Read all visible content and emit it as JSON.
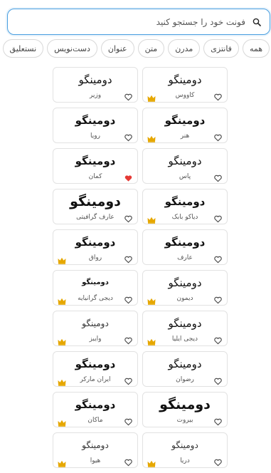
{
  "search": {
    "placeholder": "فونت خود را جستجو کنید",
    "icon": "search-icon"
  },
  "chips": [
    "همه",
    "فانتزی",
    "مدرن",
    "متن",
    "عنوان",
    "دست‌نویس",
    "نستعلیق"
  ],
  "sample_text": "دومینگو",
  "colors": {
    "accent": "#4a9fe0",
    "crown": "#e6a700",
    "heart_active": "#e53935"
  },
  "fonts": [
    {
      "name": "کاووس",
      "premium": true,
      "liked": false,
      "style": "light"
    },
    {
      "name": "وزیر",
      "premium": false,
      "liked": false,
      "style": "light"
    },
    {
      "name": "هنر",
      "premium": true,
      "liked": false,
      "style": "bold"
    },
    {
      "name": "رویا",
      "premium": false,
      "liked": false,
      "style": "bold"
    },
    {
      "name": "پاس",
      "premium": false,
      "liked": false,
      "style": "light"
    },
    {
      "name": "کمان",
      "premium": false,
      "liked": true,
      "style": "bold"
    },
    {
      "name": "دیاکو بابک",
      "premium": true,
      "liked": false,
      "style": "bold"
    },
    {
      "name": "عارف گرافیتی",
      "premium": false,
      "liked": false,
      "style": "heavy"
    },
    {
      "name": "عارف",
      "premium": false,
      "liked": false,
      "style": "bold"
    },
    {
      "name": "رواق",
      "premium": true,
      "liked": false,
      "style": "bold"
    },
    {
      "name": "دیمون",
      "premium": true,
      "liked": false,
      "style": "light"
    },
    {
      "name": "دیجی گرانیایه",
      "premium": true,
      "liked": false,
      "style": "tiny"
    },
    {
      "name": "دیجی ایلیا",
      "premium": true,
      "liked": false,
      "style": "light"
    },
    {
      "name": "وایبز",
      "premium": true,
      "liked": false,
      "style": "thin"
    },
    {
      "name": "رضوان",
      "premium": false,
      "liked": false,
      "style": "light"
    },
    {
      "name": "ایران مارکر",
      "premium": true,
      "liked": false,
      "style": "bold"
    },
    {
      "name": "بیروت",
      "premium": false,
      "liked": false,
      "style": "heavy"
    },
    {
      "name": "ماکان",
      "premium": true,
      "liked": false,
      "style": "bold"
    },
    {
      "name": "دریا",
      "premium": true,
      "liked": false,
      "style": "thin"
    },
    {
      "name": "هیوا",
      "premium": true,
      "liked": false,
      "style": "thin"
    }
  ]
}
